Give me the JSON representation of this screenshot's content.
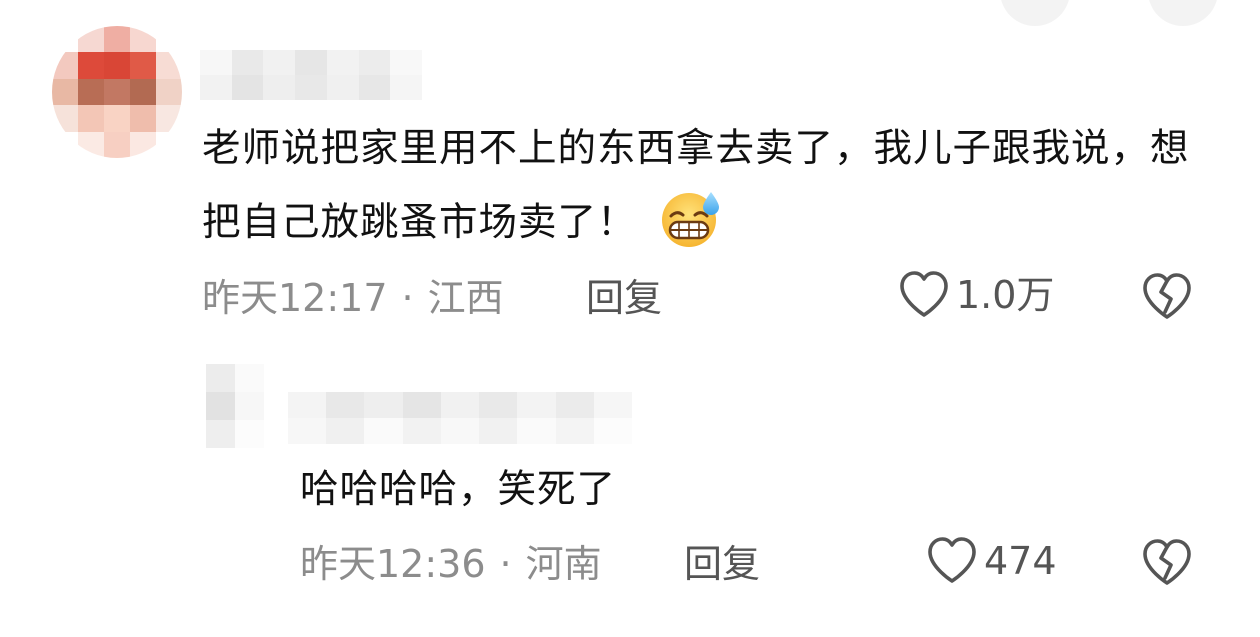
{
  "comment": {
    "text": "老师说把家里用不上的东西拿去卖了，我儿子跟我说，想把自己放跳蚤市场卖了！",
    "emoji": "grinning-sweat-emoji",
    "time": "昨天12:17",
    "separator": "·",
    "location": "江西",
    "reply_label": "回复",
    "like_count": "1.0万"
  },
  "reply": {
    "text": "哈哈哈哈，笑死了",
    "time": "昨天12:36",
    "separator": "·",
    "location": "河南",
    "reply_label": "回复",
    "like_count": "474"
  },
  "icons": {
    "like": "heart-outline-icon",
    "dislike": "broken-heart-icon"
  },
  "colors": {
    "text": "#111111",
    "meta": "#8c8c8c",
    "action": "#555555",
    "icon": "#555555",
    "background": "#ffffff"
  }
}
